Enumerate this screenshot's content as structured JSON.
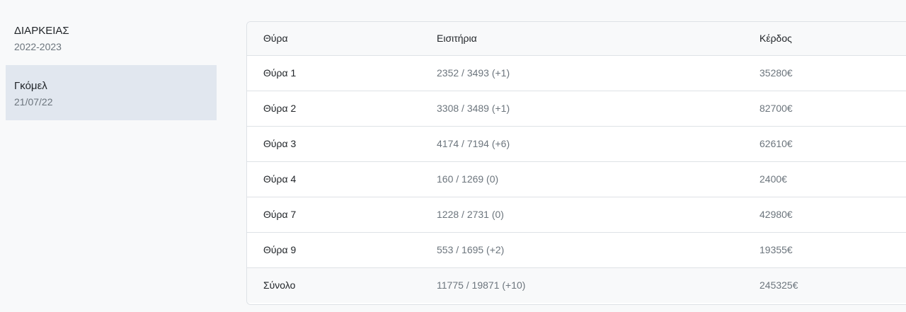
{
  "sidebar": {
    "items": [
      {
        "title": "ΔΙΑΡΚΕΙΑΣ",
        "subtitle": "2022-2023"
      },
      {
        "title": "Γκόμελ",
        "subtitle": "21/07/22"
      }
    ]
  },
  "table": {
    "headers": {
      "gate": "Θύρα",
      "tickets": "Εισιτήρια",
      "profit": "Κέρδος"
    },
    "rows": [
      {
        "gate": "Θύρα 1",
        "tickets": "2352 / 3493 (+1)",
        "profit": "35280€"
      },
      {
        "gate": "Θύρα 2",
        "tickets": "3308 / 3489 (+1)",
        "profit": "82700€"
      },
      {
        "gate": "Θύρα 3",
        "tickets": "4174 / 7194 (+6)",
        "profit": "62610€"
      },
      {
        "gate": "Θύρα 4",
        "tickets": "160 / 1269 (0)",
        "profit": "2400€"
      },
      {
        "gate": "Θύρα 7",
        "tickets": "1228 / 2731 (0)",
        "profit": "42980€"
      },
      {
        "gate": "Θύρα 9",
        "tickets": "553 / 1695 (+2)",
        "profit": "19355€"
      }
    ],
    "total": {
      "gate": "Σύνολο",
      "tickets": "11775 / 19871 (+10)",
      "profit": "245325€"
    }
  }
}
